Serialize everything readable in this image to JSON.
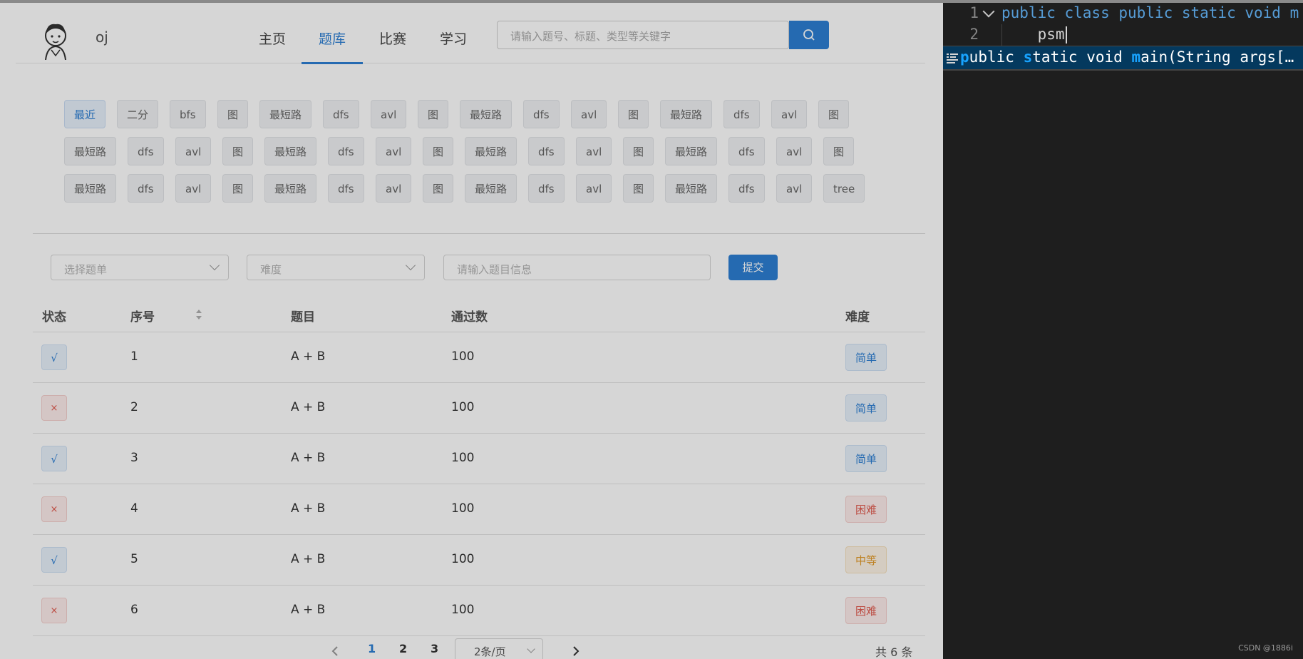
{
  "navbar": {
    "brand": "oj",
    "items": [
      {
        "label": "主页"
      },
      {
        "label": "题库",
        "active": true
      },
      {
        "label": "比赛"
      },
      {
        "label": "学习"
      }
    ],
    "search_placeholder": "请输入题号、标题、类型等关键字",
    "search_icon": "search-icon"
  },
  "tags": {
    "rows": [
      [
        "最近",
        "二分",
        "bfs",
        "图",
        "最短路",
        "dfs",
        "avl",
        "图",
        "最短路",
        "dfs",
        "avl",
        "图",
        "最短路",
        "dfs",
        "avl",
        "图"
      ],
      [
        "最短路",
        "dfs",
        "avl",
        "图",
        "最短路",
        "dfs",
        "avl",
        "图",
        "最短路",
        "dfs",
        "avl",
        "图",
        "最短路",
        "dfs",
        "avl",
        "图"
      ],
      [
        "最短路",
        "dfs",
        "avl",
        "图",
        "最短路",
        "dfs",
        "avl",
        "图",
        "最短路",
        "dfs",
        "avl",
        "图",
        "最短路",
        "dfs",
        "avl",
        "tree"
      ]
    ],
    "active": "最近"
  },
  "filters": {
    "list_placeholder": "选择题单",
    "difficulty_placeholder": "难度",
    "info_placeholder": "请输入题目信息",
    "submit_label": "提交"
  },
  "table": {
    "headers": {
      "status": "状态",
      "index": "序号",
      "title": "题目",
      "passed": "通过数",
      "difficulty": "难度"
    },
    "rows": [
      {
        "status": "√",
        "status_type": "ok",
        "index": "1",
        "title": "A + B",
        "passed": "100",
        "difficulty": "简单",
        "difficulty_type": "easy"
      },
      {
        "status": "×",
        "status_type": "bad",
        "index": "2",
        "title": "A + B",
        "passed": "100",
        "difficulty": "简单",
        "difficulty_type": "easy"
      },
      {
        "status": "√",
        "status_type": "ok",
        "index": "3",
        "title": "A + B",
        "passed": "100",
        "difficulty": "简单",
        "difficulty_type": "easy"
      },
      {
        "status": "×",
        "status_type": "bad",
        "index": "4",
        "title": "A + B",
        "passed": "100",
        "difficulty": "困难",
        "difficulty_type": "hard"
      },
      {
        "status": "√",
        "status_type": "ok",
        "index": "5",
        "title": "A + B",
        "passed": "100",
        "difficulty": "中等",
        "difficulty_type": "mid"
      },
      {
        "status": "×",
        "status_type": "bad",
        "index": "6",
        "title": "A + B",
        "passed": "100",
        "difficulty": "困难",
        "difficulty_type": "hard"
      }
    ]
  },
  "pagination": {
    "pages": [
      "1",
      "2",
      "3"
    ],
    "current": "1",
    "page_size": "2条/页",
    "total": "共 6 条"
  },
  "editor": {
    "lines": [
      {
        "number": "1",
        "text": "public class public static void m"
      },
      {
        "number": "2",
        "text": "    psm"
      }
    ],
    "suggestion": {
      "icon": "snippet-icon",
      "text": "public static void main(String args[]…",
      "highlight_chars": [
        "p",
        "s",
        "m"
      ]
    },
    "watermark": "CSDN @1886i"
  },
  "colors": {
    "accent": "#2d7fd3",
    "editor_bg": "#1e1e1e",
    "keyword": "#569cd6",
    "suggest_bg": "#04395e",
    "match": "#18a3ff"
  }
}
